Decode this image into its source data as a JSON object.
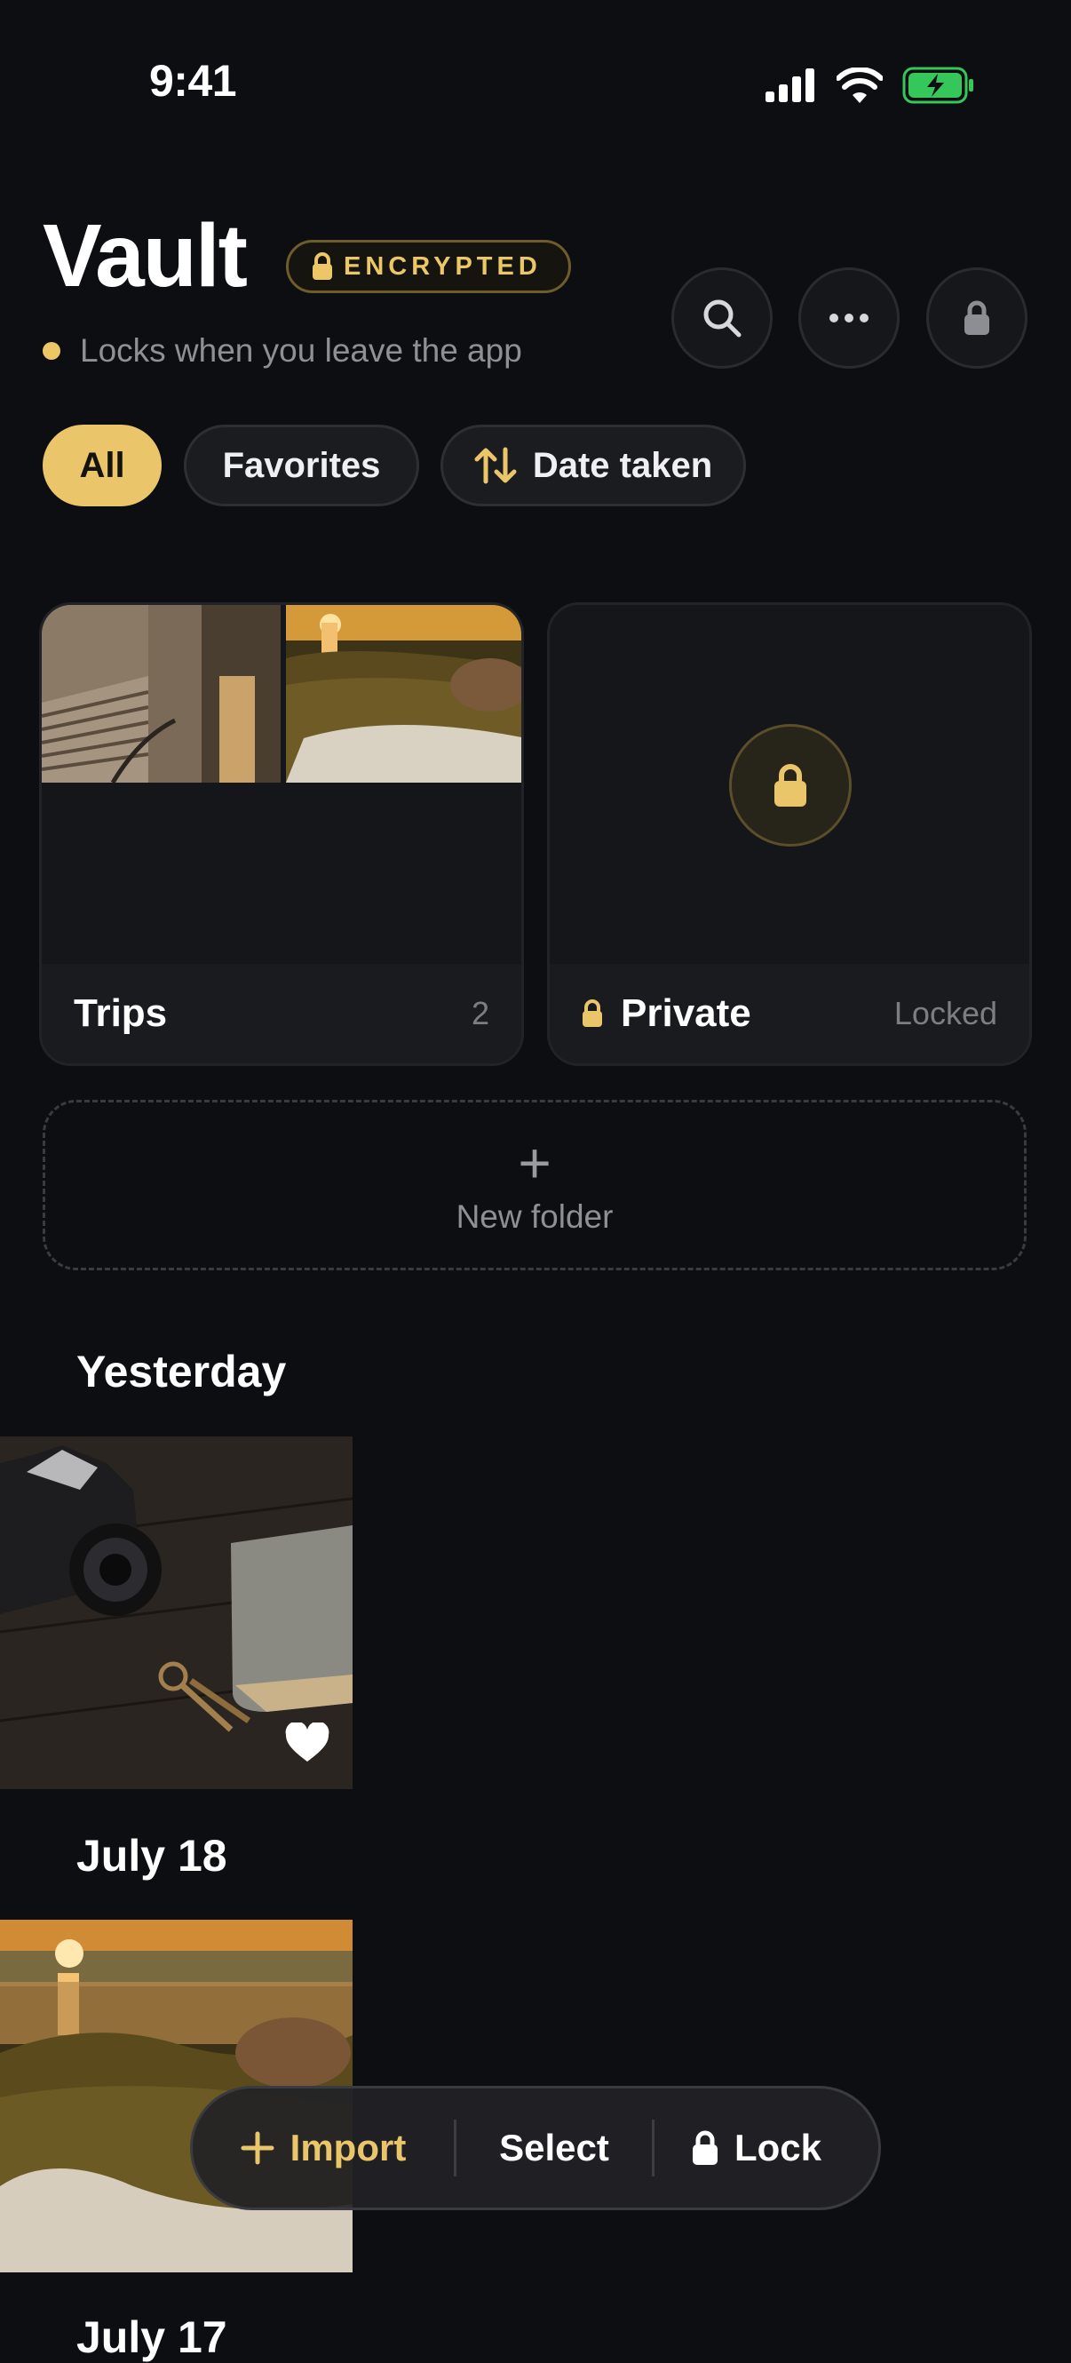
{
  "status": {
    "time": "9:41"
  },
  "header": {
    "title": "Vault",
    "badge": "ENCRYPTED",
    "subtitle": "Locks when you leave the app"
  },
  "filters": [
    {
      "label": "All",
      "active": true
    },
    {
      "label": "Favorites",
      "active": false
    },
    {
      "label": "Date taken",
      "active": false,
      "icon": "sort-arrows-icon"
    }
  ],
  "folders": [
    {
      "name": "Trips",
      "meta": "2"
    },
    {
      "name": "Private",
      "meta": "Locked"
    }
  ],
  "new_folder": {
    "label": "New folder"
  },
  "sections": [
    {
      "title": "Yesterday"
    },
    {
      "title": "July 18"
    },
    {
      "title": "July 17"
    }
  ],
  "toolbar": {
    "import_label": "Import",
    "select_label": "Select",
    "lock_label": "Lock"
  },
  "colors": {
    "background": "#0d0e12",
    "accent": "#ebc56a",
    "battery": "#35c759"
  }
}
